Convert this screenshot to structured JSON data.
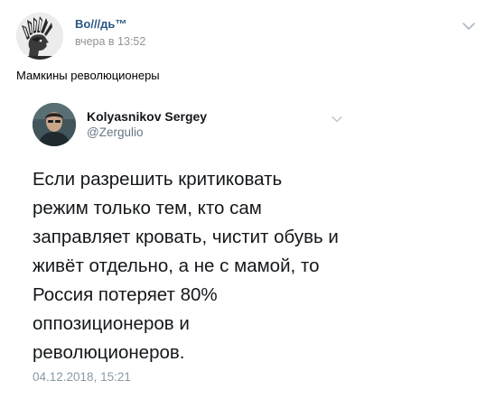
{
  "post": {
    "author_name": "Во///дь™",
    "timestamp": "вчера в 13:52",
    "text": "Мамкины революционеры",
    "menu_icon": "chevron-down-icon"
  },
  "embedded_tweet": {
    "author_name": "Kolyasnikov Sergey",
    "handle": "@Zergulio",
    "text": "Если разрешить критиковать\nрежим только тем, кто сам\nзаправляет кровать, чистит обувь и\nживёт отдельно, а не с мамой, то\nРоссия потеряет 80%\nоппозиционеров и\nреволюционеров.",
    "date": "04.12.2018, 15:21",
    "menu_icon": "chevron-down-icon"
  },
  "colors": {
    "link": "#2a5885",
    "meta": "#939393",
    "tweet_text": "#14171a",
    "tweet_secondary": "#657786"
  }
}
